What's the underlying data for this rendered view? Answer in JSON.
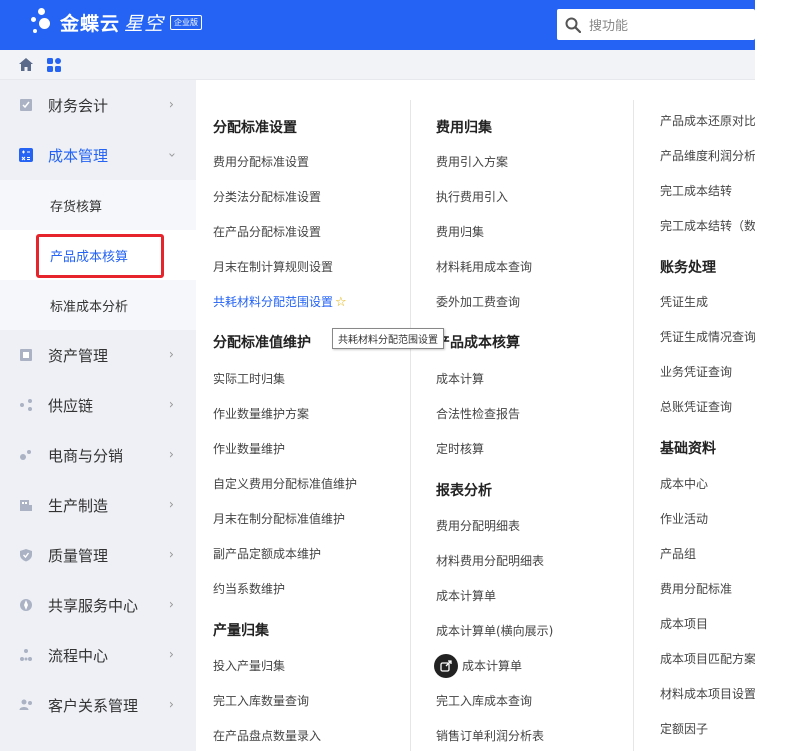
{
  "brand": {
    "name": "金蝶云",
    "sub": "星空",
    "edition": "企业版"
  },
  "search": {
    "placeholder": "搜功能"
  },
  "sidebar": {
    "items": [
      {
        "label": "财务会计",
        "icon": "finance-icon"
      },
      {
        "label": "成本管理",
        "icon": "calculator-icon",
        "expanded": true
      },
      {
        "label": "资产管理",
        "icon": "asset-icon"
      },
      {
        "label": "供应链",
        "icon": "supply-chain-icon"
      },
      {
        "label": "电商与分销",
        "icon": "ecommerce-icon"
      },
      {
        "label": "生产制造",
        "icon": "factory-icon"
      },
      {
        "label": "质量管理",
        "icon": "shield-icon"
      },
      {
        "label": "共享服务中心",
        "icon": "shared-service-icon"
      },
      {
        "label": "流程中心",
        "icon": "process-icon"
      },
      {
        "label": "客户关系管理",
        "icon": "customer-icon"
      }
    ],
    "sub_items": [
      {
        "label": "存货核算"
      },
      {
        "label": "产品成本核算",
        "active": true
      },
      {
        "label": "标准成本分析"
      }
    ]
  },
  "columns": {
    "col1": {
      "sections": [
        {
          "title": "分配标准设置",
          "links": [
            "费用分配标准设置",
            "分类法分配标准设置",
            "在产品分配标准设置",
            "月末在制计算规则设置",
            "共耗材料分配范围设置"
          ]
        },
        {
          "title": "分配标准值维护",
          "links": [
            "实际工时归集",
            "作业数量维护方案",
            "作业数量维护",
            "自定义费用分配标准值维护",
            "月末在制分配标准值维护",
            "副产品定额成本维护",
            "约当系数维护"
          ]
        },
        {
          "title": "产量归集",
          "links": [
            "投入产量归集",
            "完工入库数量查询",
            "在产品盘点数量录入"
          ]
        }
      ]
    },
    "col2": {
      "sections": [
        {
          "title": "费用归集",
          "links": [
            "费用引入方案",
            "执行费用引入",
            "费用归集",
            "材料耗用成本查询",
            "委外加工费查询"
          ]
        },
        {
          "title": "产品成本核算",
          "links": [
            "成本计算",
            "合法性检查报告",
            "定时核算"
          ]
        },
        {
          "title": "报表分析",
          "links": [
            "费用分配明细表",
            "材料费用分配明细表",
            "成本计算单",
            "成本计算单(横向展示)",
            "成本计算单",
            "完工入库成本查询",
            "销售订单利润分析表"
          ]
        }
      ]
    },
    "col3": {
      "top_links": [
        "产品成本还原对比",
        "产品维度利润分析",
        "完工成本结转",
        "完工成本结转（数"
      ],
      "sections": [
        {
          "title": "账务处理",
          "links": [
            "凭证生成",
            "凭证生成情况查询",
            "业务凭证查询",
            "总账凭证查询"
          ]
        },
        {
          "title": "基础资料",
          "links": [
            "成本中心",
            "作业活动",
            "产品组",
            "费用分配标准",
            "成本项目",
            "成本项目匹配方案",
            "材料成本项目设置",
            "定额因子"
          ]
        }
      ]
    }
  },
  "tooltip": {
    "text": "共耗材料分配范围设置"
  },
  "colors": {
    "brand_blue": "#2463f4",
    "highlight_red": "#e5242b",
    "sidebar_bg": "#eef0f5"
  }
}
